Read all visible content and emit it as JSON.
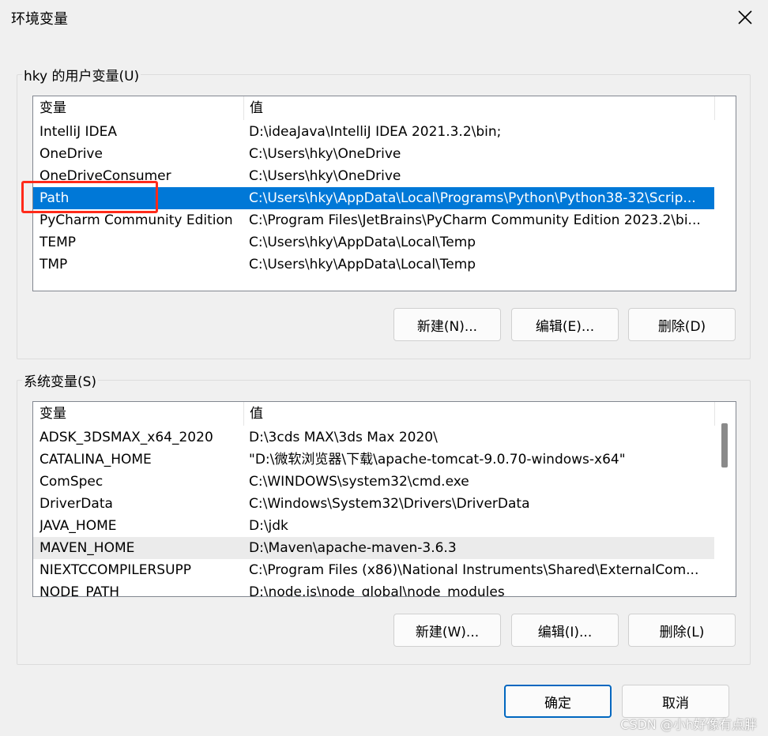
{
  "window": {
    "title": "环境变量"
  },
  "user_vars": {
    "label": "hky 的用户变量(U)",
    "columns": [
      "变量",
      "值"
    ],
    "rows": [
      {
        "name": "IntelliJ IDEA",
        "value": "D:\\ideaJava\\IntelliJ IDEA 2021.3.2\\bin;"
      },
      {
        "name": "OneDrive",
        "value": "C:\\Users\\hky\\OneDrive"
      },
      {
        "name": "OneDriveConsumer",
        "value": "C:\\Users\\hky\\OneDrive"
      },
      {
        "name": "Path",
        "value": "C:\\Users\\hky\\AppData\\Local\\Programs\\Python\\Python38-32\\Scrip..."
      },
      {
        "name": "PyCharm Community Edition",
        "value": "C:\\Program Files\\JetBrains\\PyCharm Community Edition 2023.2\\bi..."
      },
      {
        "name": "TEMP",
        "value": "C:\\Users\\hky\\AppData\\Local\\Temp"
      },
      {
        "name": "TMP",
        "value": "C:\\Users\\hky\\AppData\\Local\\Temp"
      }
    ],
    "selected_index": 3,
    "buttons": {
      "new": "新建(N)...",
      "edit": "编辑(E)...",
      "delete": "删除(D)"
    }
  },
  "system_vars": {
    "label": "系统变量(S)",
    "columns": [
      "变量",
      "值"
    ],
    "rows": [
      {
        "name": "ADSK_3DSMAX_x64_2020",
        "value": "D:\\3cds MAX\\3ds Max 2020\\"
      },
      {
        "name": "CATALINA_HOME",
        "value": "\"D:\\微软浏览器\\下载\\apache-tomcat-9.0.70-windows-x64\""
      },
      {
        "name": "ComSpec",
        "value": "C:\\WINDOWS\\system32\\cmd.exe"
      },
      {
        "name": "DriverData",
        "value": "C:\\Windows\\System32\\Drivers\\DriverData"
      },
      {
        "name": "JAVA_HOME",
        "value": "D:\\jdk"
      },
      {
        "name": "MAVEN_HOME",
        "value": "D:\\Maven\\apache-maven-3.6.3"
      },
      {
        "name": "NIEXTCCOMPILERSUPP",
        "value": "C:\\Program Files (x86)\\National Instruments\\Shared\\ExternalCom..."
      },
      {
        "name": "NODE_PATH",
        "value": "D:\\node.js\\node_global\\node_modules"
      }
    ],
    "hover_index": 5,
    "buttons": {
      "new": "新建(W)...",
      "edit": "编辑(I)...",
      "delete": "删除(L)"
    }
  },
  "footer": {
    "ok": "确定",
    "cancel": "取消"
  },
  "watermark": "CSDN @小h好像有点胖",
  "colors": {
    "selection": "#0078d7",
    "annotation_box": "#ff2a1a",
    "default_button_border": "#0067c0"
  }
}
